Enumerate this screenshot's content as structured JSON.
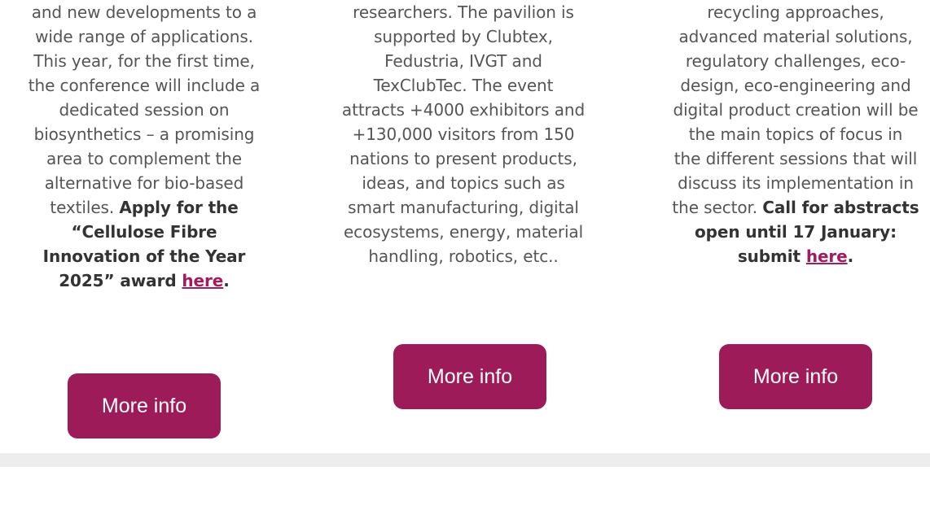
{
  "columns": [
    {
      "text_lines": [
        "and new developments to a",
        "wide range of applications.",
        "This year, for the first time,",
        "the conference will include a",
        "dedicated session on",
        "biosynthetics – a promising",
        "area to complement the",
        "alternative for bio-based"
      ],
      "line_mixed": "textiles. ",
      "bold_lines": [
        "Apply for the",
        "“Cellulose Fibre",
        "Innovation of the Year",
        "2025” award "
      ],
      "link_text": "here",
      "link_suffix": ".",
      "button_label": "More info"
    },
    {
      "text_lines": [
        "researchers. The pavilion is",
        "supported by Clubtex,",
        "Fedustria, IVGT and",
        "TexClubTec. The event",
        "attracts +4000 exhibitors and",
        "+130,000 visitors from 150",
        "nations to present products,",
        "ideas, and topics such as",
        "smart manufacturing, digital",
        "ecosystems, energy, material",
        "handling, robotics, etc.."
      ],
      "button_label": "More info"
    },
    {
      "text_lines": [
        "recycling approaches,",
        "advanced material solutions,",
        "regulatory challenges, eco-",
        "design, eco-engineering and",
        "digital product creation will be",
        "the main topics of focus in",
        "the different sessions that will",
        "discuss its implementation in"
      ],
      "line_mixed": "the sector. ",
      "bold_lines": [
        "Call for abstracts",
        "open until 17 January:",
        "submit "
      ],
      "link_text": "here",
      "link_suffix": ".",
      "button_label": "More info"
    }
  ],
  "colors": {
    "button_bg": "#9e1b5a",
    "link": "#a31c5e",
    "divider": "#ededed"
  }
}
